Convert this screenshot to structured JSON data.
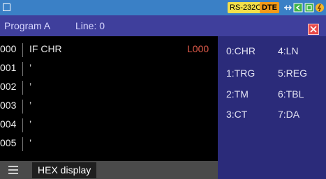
{
  "status": {
    "rs_label": "RS-232C",
    "dte_label": "DTE",
    "icons": [
      "menu-square-icon",
      "usb-icon",
      "back-icon",
      "record-icon",
      "power-icon"
    ]
  },
  "program": {
    "name": "Program A",
    "line_info": "Line: 0"
  },
  "editor": {
    "rows": [
      {
        "num": "000",
        "code": "IF  CHR",
        "label": "L000"
      },
      {
        "num": "001",
        "code": "’",
        "label": ""
      },
      {
        "num": "002",
        "code": "’",
        "label": ""
      },
      {
        "num": "003",
        "code": "’",
        "label": ""
      },
      {
        "num": "004",
        "code": "’",
        "label": ""
      },
      {
        "num": "005",
        "code": "’",
        "label": ""
      }
    ]
  },
  "bottom": {
    "hex_label": "HEX display"
  },
  "options": [
    "0:CHR",
    "4:LN",
    "1:TRG",
    "5:REG",
    "2:TM",
    "6:TBL",
    "3:CT",
    "7:DA"
  ],
  "colors": {
    "status_bar": "#3a80c6",
    "title_bar": "#3f3f9c",
    "editor_bg": "#000000",
    "panel_bg": "#2b2b7a",
    "label_red": "#e25b4a"
  }
}
